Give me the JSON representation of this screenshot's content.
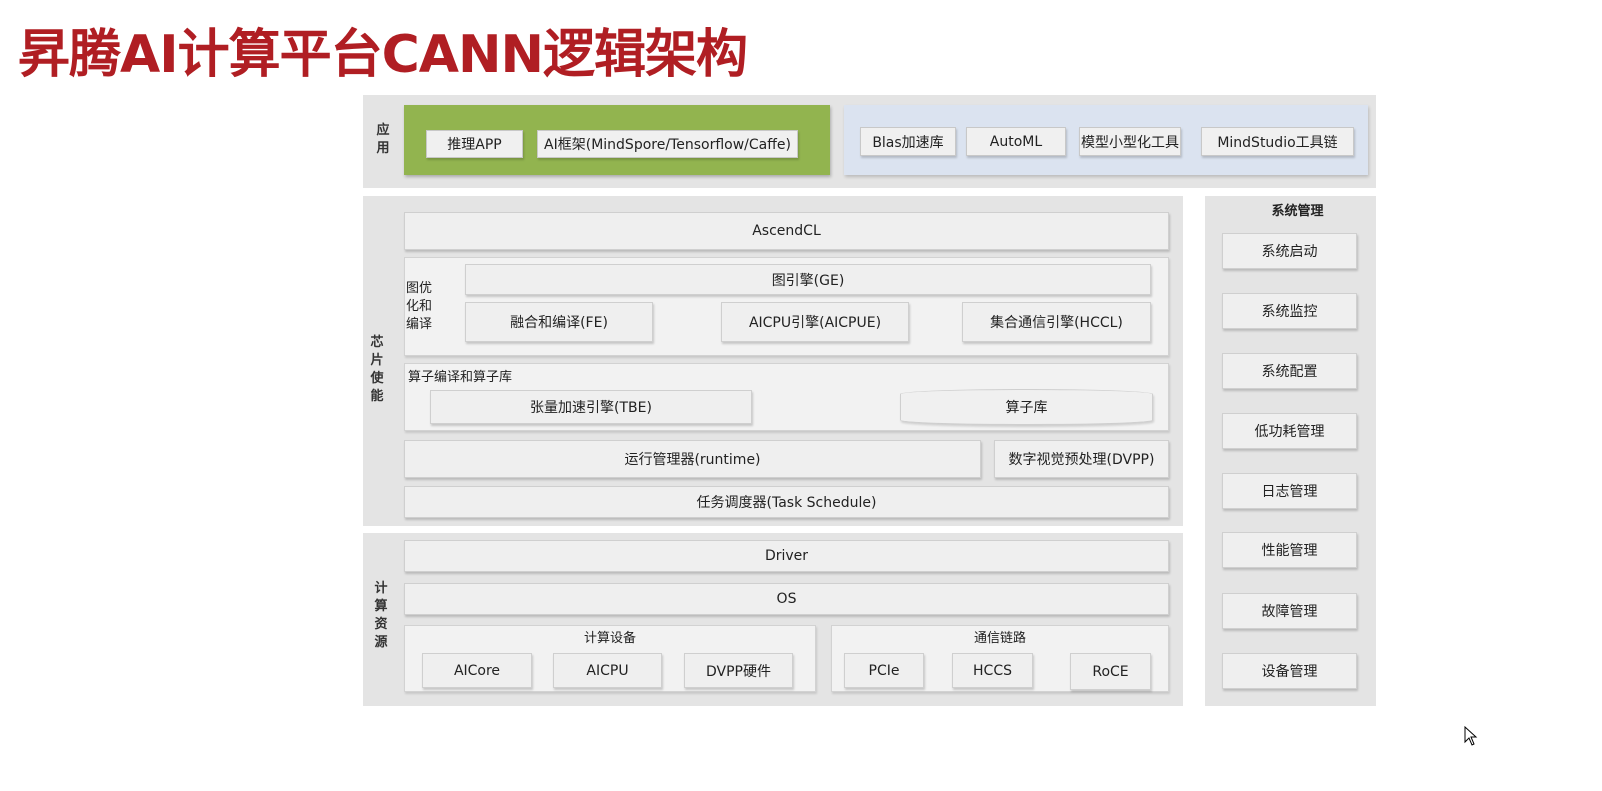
{
  "title": "昇腾AI计算平台CANN逻辑架构",
  "colors": {
    "title": "#b01e23",
    "app_green": "#92b44f",
    "app_blue": "#dbe3f0",
    "panel": "#e4e4e4"
  },
  "app": {
    "label": "应用",
    "green_items": [
      "推理APP",
      "AI框架(MindSpore/Tensorflow/Caffe)"
    ],
    "blue_items": [
      "Blas加速库",
      "AutoML",
      "模型小型化工具",
      "MindStudio工具链"
    ]
  },
  "chip": {
    "label": "芯片使能",
    "ascendcl": "AscendCL",
    "graph_opt_label": "图优化和编译",
    "ge": "图引擎(GE)",
    "engines": [
      "融合和编译(FE)",
      "AICPU引擎(AICPUE)",
      "集合通信引擎(HCCL)"
    ],
    "op_label": "算子编译和算子库",
    "tbe": "张量加速引擎(TBE)",
    "oplib": "算子库",
    "runtime": "运行管理器(runtime)",
    "dvpp": "数字视觉预处理(DVPP)",
    "task": "任务调度器(Task Schedule)"
  },
  "compute": {
    "label": "计算资源",
    "driver": "Driver",
    "os": "OS",
    "devices_label": "计算设备",
    "devices": [
      "AICore",
      "AICPU",
      "DVPP硬件"
    ],
    "links_label": "通信链路",
    "links": [
      "PCIe",
      "HCCS",
      "RoCE"
    ]
  },
  "sysmgmt": {
    "label": "系统管理",
    "items": [
      "系统启动",
      "系统监控",
      "系统配置",
      "低功耗管理",
      "日志管理",
      "性能管理",
      "故障管理",
      "设备管理"
    ]
  }
}
